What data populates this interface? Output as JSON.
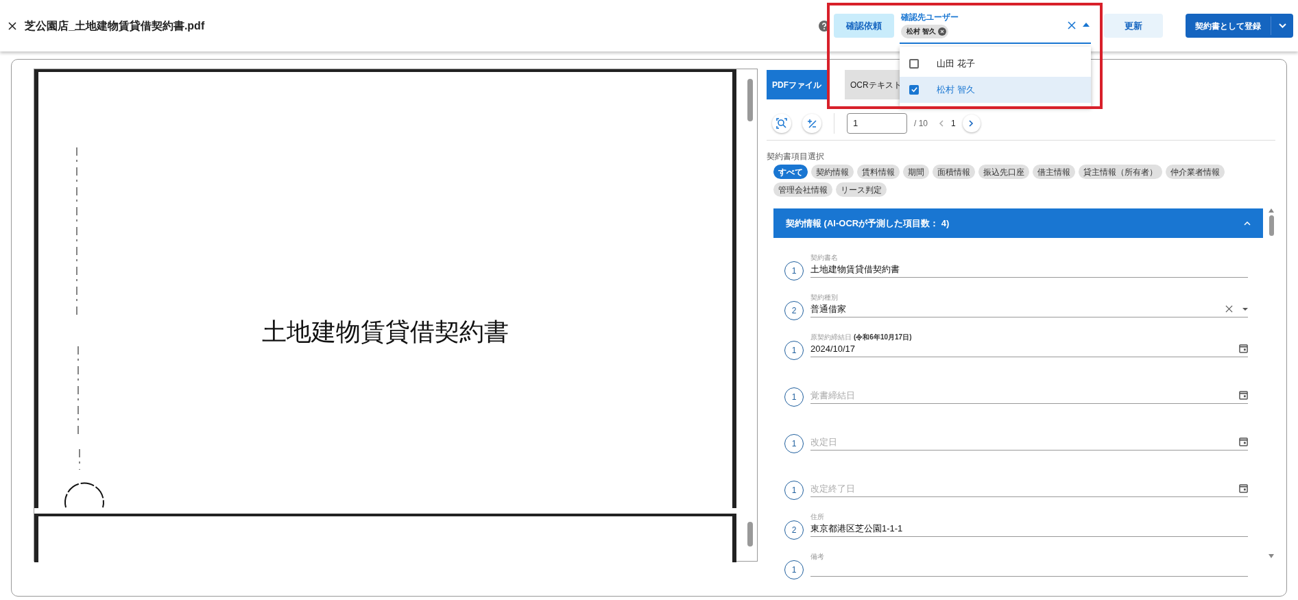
{
  "header": {
    "title": "芝公園店_土地建物賃貸借契約書.pdf"
  },
  "actions": {
    "request_button": "確認依頼",
    "reviewer_select": {
      "label": "確認先ユーザー",
      "chips": [
        "松村 智久"
      ],
      "expanded": true,
      "options": [
        {
          "label": "山田 花子",
          "checked": false
        },
        {
          "label": "松村 智久",
          "checked": true
        }
      ]
    },
    "update_button": "更新",
    "register_button": "契約書として登録"
  },
  "pdf_viewer": {
    "document_title": "土地建物賃貸借契約書"
  },
  "tabs": [
    {
      "label": "PDFファイル",
      "selected": true
    },
    {
      "label": "OCRテキスト",
      "selected": false
    }
  ],
  "pager": {
    "page_input": "1",
    "total": "/ 10",
    "current": "1"
  },
  "filter": {
    "label": "契約書項目選択",
    "chips": [
      {
        "label": "すべて",
        "selected": true
      },
      {
        "label": "契約情報",
        "selected": false
      },
      {
        "label": "賃料情報",
        "selected": false
      },
      {
        "label": "期間",
        "selected": false
      },
      {
        "label": "面積情報",
        "selected": false
      },
      {
        "label": "振込先口座",
        "selected": false
      },
      {
        "label": "借主情報",
        "selected": false
      },
      {
        "label": "貸主情報（所有者）",
        "selected": false
      },
      {
        "label": "仲介業者情報",
        "selected": false
      },
      {
        "label": "管理会社情報",
        "selected": false
      },
      {
        "label": "リース判定",
        "selected": false
      }
    ]
  },
  "section": {
    "title": "契約情報 (AI-OCRが予測した項目数： 4)",
    "expanded": true
  },
  "fields": [
    {
      "kind": "text",
      "count": "1",
      "label": "契約書名",
      "value": "土地建物賃貸借契約書"
    },
    {
      "kind": "select",
      "count": "2",
      "label": "契約種別",
      "value": "普通借家"
    },
    {
      "kind": "date",
      "count": "1",
      "label": "原契約締結日",
      "note": "(令和6年10月17日)",
      "value": "2024/10/17"
    },
    {
      "kind": "date",
      "count": "1",
      "placeholder": "覚書締結日"
    },
    {
      "kind": "date",
      "count": "1",
      "placeholder": "改定日"
    },
    {
      "kind": "date",
      "count": "1",
      "placeholder": "改定終了日"
    },
    {
      "kind": "text",
      "count": "2",
      "label": "住所",
      "value": "東京都港区芝公園1-1-1"
    },
    {
      "kind": "text",
      "count": "1",
      "label": "備考"
    }
  ]
}
